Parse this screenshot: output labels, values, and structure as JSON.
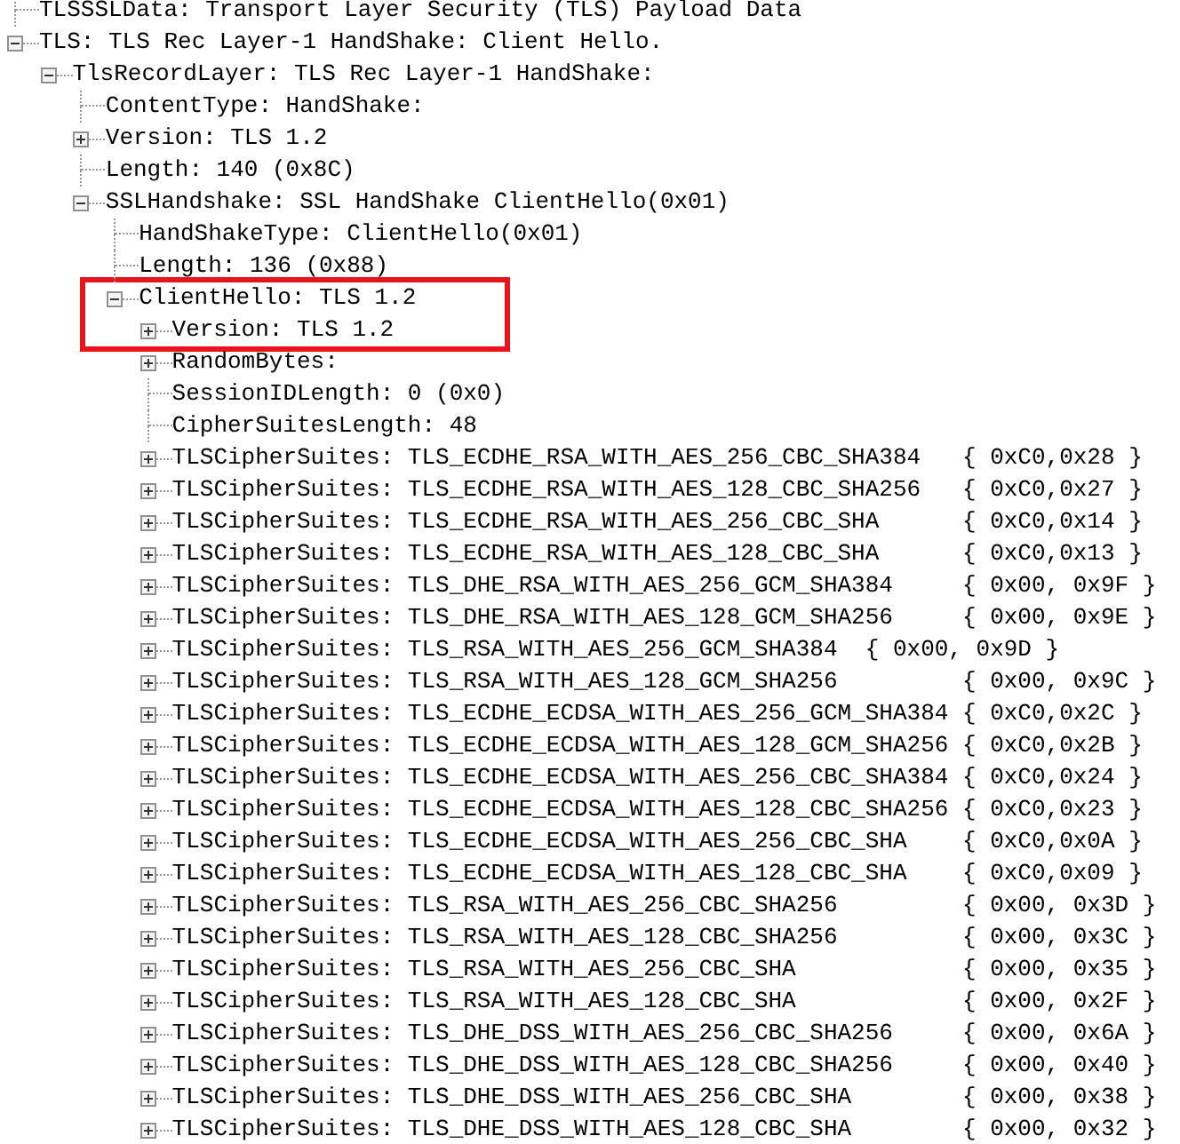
{
  "tree": [
    {
      "label": "TLSSSLData: Transport Layer Security (TLS) Payload Data",
      "highlighted": false
    },
    {
      "label": "TLS: TLS Rec Layer-1 HandShake: Client Hello.",
      "highlighted": false,
      "expanded": true,
      "children": [
        {
          "label": "TlsRecordLayer: TLS Rec Layer-1 HandShake:",
          "highlighted": false,
          "expanded": true,
          "children": [
            {
              "label": "ContentType: HandShake:",
              "highlighted": false
            },
            {
              "label": "Version: TLS 1.2",
              "highlighted": false,
              "expanded": false
            },
            {
              "label": "Length: 140 (0x8C)",
              "highlighted": false
            },
            {
              "label": "SSLHandshake: SSL HandShake ClientHello(0x01)",
              "highlighted": false,
              "expanded": true,
              "children": [
                {
                  "label": "HandShakeType: ClientHello(0x01)",
                  "highlighted": false
                },
                {
                  "label": "Length: 136 (0x88)",
                  "highlighted": false
                },
                {
                  "label": "ClientHello: TLS 1.2",
                  "highlighted": true,
                  "expanded": true,
                  "children": [
                    {
                      "label": "Version: TLS 1.2",
                      "highlighted": true,
                      "expanded": false
                    },
                    {
                      "label": "RandomBytes:",
                      "highlighted": false,
                      "expanded": false
                    },
                    {
                      "label": "SessionIDLength: 0 (0x0)",
                      "highlighted": false
                    },
                    {
                      "label": "CipherSuitesLength: 48",
                      "highlighted": false
                    },
                    {
                      "label": "TLSCipherSuites: TLS_ECDHE_RSA_WITH_AES_256_CBC_SHA384   { 0xC0,0x28 }",
                      "highlighted": false,
                      "expanded": false
                    },
                    {
                      "label": "TLSCipherSuites: TLS_ECDHE_RSA_WITH_AES_128_CBC_SHA256   { 0xC0,0x27 }",
                      "highlighted": false,
                      "expanded": false
                    },
                    {
                      "label": "TLSCipherSuites: TLS_ECDHE_RSA_WITH_AES_256_CBC_SHA      { 0xC0,0x14 }",
                      "highlighted": false,
                      "expanded": false
                    },
                    {
                      "label": "TLSCipherSuites: TLS_ECDHE_RSA_WITH_AES_128_CBC_SHA      { 0xC0,0x13 }",
                      "highlighted": false,
                      "expanded": false
                    },
                    {
                      "label": "TLSCipherSuites: TLS_DHE_RSA_WITH_AES_256_GCM_SHA384     { 0x00, 0x9F }",
                      "highlighted": false,
                      "expanded": false
                    },
                    {
                      "label": "TLSCipherSuites: TLS_DHE_RSA_WITH_AES_128_GCM_SHA256     { 0x00, 0x9E }",
                      "highlighted": false,
                      "expanded": false
                    },
                    {
                      "label": "TLSCipherSuites: TLS_RSA_WITH_AES_256_GCM_SHA384  { 0x00, 0x9D }",
                      "highlighted": false,
                      "expanded": false
                    },
                    {
                      "label": "TLSCipherSuites: TLS_RSA_WITH_AES_128_GCM_SHA256         { 0x00, 0x9C }",
                      "highlighted": false,
                      "expanded": false
                    },
                    {
                      "label": "TLSCipherSuites: TLS_ECDHE_ECDSA_WITH_AES_256_GCM_SHA384 { 0xC0,0x2C }",
                      "highlighted": false,
                      "expanded": false
                    },
                    {
                      "label": "TLSCipherSuites: TLS_ECDHE_ECDSA_WITH_AES_128_GCM_SHA256 { 0xC0,0x2B }",
                      "highlighted": false,
                      "expanded": false
                    },
                    {
                      "label": "TLSCipherSuites: TLS_ECDHE_ECDSA_WITH_AES_256_CBC_SHA384 { 0xC0,0x24 }",
                      "highlighted": false,
                      "expanded": false
                    },
                    {
                      "label": "TLSCipherSuites: TLS_ECDHE_ECDSA_WITH_AES_128_CBC_SHA256 { 0xC0,0x23 }",
                      "highlighted": false,
                      "expanded": false
                    },
                    {
                      "label": "TLSCipherSuites: TLS_ECDHE_ECDSA_WITH_AES_256_CBC_SHA    { 0xC0,0x0A }",
                      "highlighted": false,
                      "expanded": false
                    },
                    {
                      "label": "TLSCipherSuites: TLS_ECDHE_ECDSA_WITH_AES_128_CBC_SHA    { 0xC0,0x09 }",
                      "highlighted": false,
                      "expanded": false
                    },
                    {
                      "label": "TLSCipherSuites: TLS_RSA_WITH_AES_256_CBC_SHA256         { 0x00, 0x3D }",
                      "highlighted": false,
                      "expanded": false
                    },
                    {
                      "label": "TLSCipherSuites: TLS_RSA_WITH_AES_128_CBC_SHA256         { 0x00, 0x3C }",
                      "highlighted": false,
                      "expanded": false
                    },
                    {
                      "label": "TLSCipherSuites: TLS_RSA_WITH_AES_256_CBC_SHA            { 0x00, 0x35 }",
                      "highlighted": false,
                      "expanded": false
                    },
                    {
                      "label": "TLSCipherSuites: TLS_RSA_WITH_AES_128_CBC_SHA            { 0x00, 0x2F }",
                      "highlighted": false,
                      "expanded": false
                    },
                    {
                      "label": "TLSCipherSuites: TLS_DHE_DSS_WITH_AES_256_CBC_SHA256     { 0x00, 0x6A }",
                      "highlighted": false,
                      "expanded": false
                    },
                    {
                      "label": "TLSCipherSuites: TLS_DHE_DSS_WITH_AES_128_CBC_SHA256     { 0x00, 0x40 }",
                      "highlighted": false,
                      "expanded": false
                    },
                    {
                      "label": "TLSCipherSuites: TLS_DHE_DSS_WITH_AES_256_CBC_SHA        { 0x00, 0x38 }",
                      "highlighted": false,
                      "expanded": false
                    },
                    {
                      "label": "TLSCipherSuites: TLS_DHE_DSS_WITH_AES_128_CBC_SHA        { 0x00, 0x32 }",
                      "highlighted": false,
                      "expanded": false
                    }
                  ]
                }
              ]
            }
          ]
        }
      ]
    }
  ]
}
